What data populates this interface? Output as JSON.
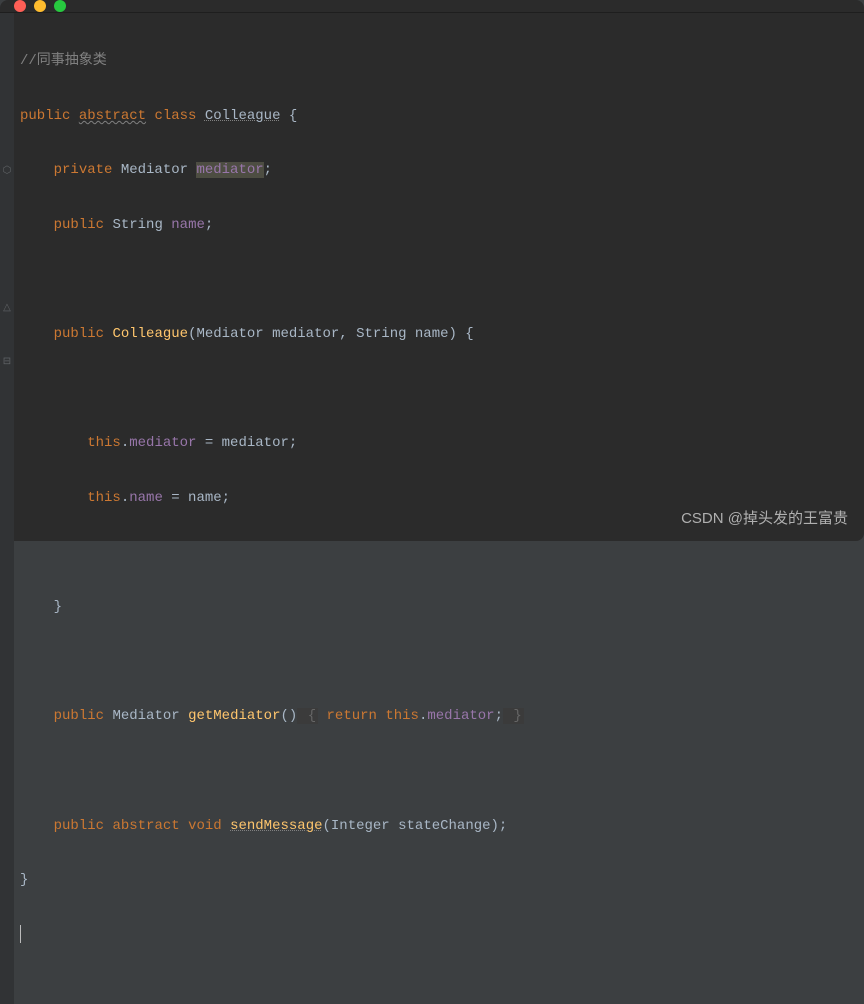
{
  "comment": "//同事抽象类",
  "l1": {
    "public": "public",
    "abstract": "abstract",
    "class": "class",
    "name": "Colleague",
    "open": " {"
  },
  "l2": {
    "private": "private",
    "type": "Mediator",
    "field": "mediator",
    "semi": ";"
  },
  "l3": {
    "public": "public",
    "type": "String",
    "field": "name",
    "semi": ";"
  },
  "ctor": {
    "public": "public",
    "name": "Colleague",
    "params": "(Mediator mediator, String name) {"
  },
  "assign1": {
    "this": "this",
    "dot": ".",
    "field": "mediator",
    "eq": " = mediator;"
  },
  "assign2": {
    "this": "this",
    "dot": ".",
    "field": "name",
    "eq": " = name;"
  },
  "closeCtor": "}",
  "getter": {
    "public": "public",
    "type": "Mediator",
    "name": "getMediator",
    "parens": "()",
    "open": " {",
    "return": "return",
    "this": "this",
    "dot": ".",
    "field": "mediator",
    "semi": ";",
    "close": " }"
  },
  "abst": {
    "public": "public",
    "abstract": "abstract",
    "void": "void",
    "name": "sendMessage",
    "params": "(Integer stateChange);"
  },
  "closeClass": "}",
  "watermark": "CSDN @掉头发的王富贵",
  "gutterIcons": {
    "override": "⬡",
    "collapse": "⊟",
    "up": "△"
  }
}
